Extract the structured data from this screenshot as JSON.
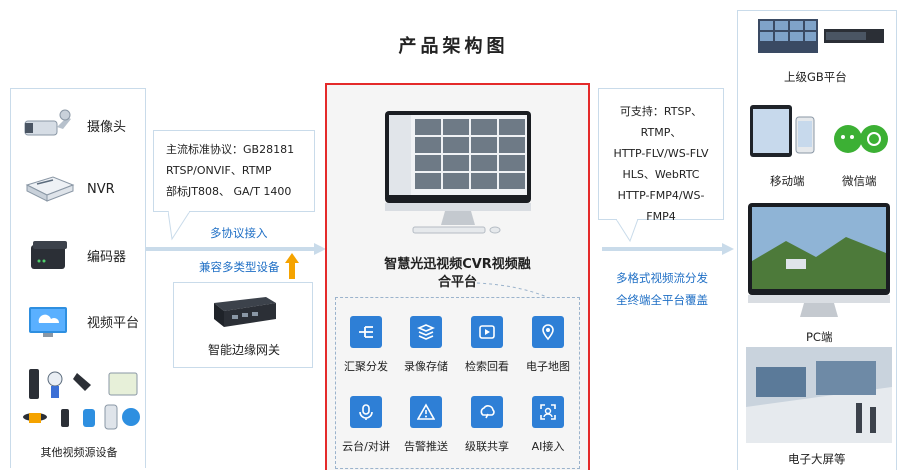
{
  "title": "产品架构图",
  "sources": [
    {
      "label": "摄像头",
      "icon": "camera-icon"
    },
    {
      "label": "NVR",
      "icon": "nvr-icon"
    },
    {
      "label": "编码器",
      "icon": "encoder-icon"
    },
    {
      "label": "视频平台",
      "icon": "video-platform-icon"
    }
  ],
  "other_sources_label": "其他视频源设备",
  "protocols_in": {
    "lines": [
      "主流标准协议：GB28181",
      "RTSP/ONVIF、RTMP",
      "部标JT808、 GA/T 1400"
    ],
    "caption": "多协议接入"
  },
  "compat_label": "兼容多类型设备",
  "gateway_label": "智能边缘网关",
  "platform": {
    "name_line1": "智慧光迅视频CVR视频融",
    "name_line2": "合平台"
  },
  "features": [
    {
      "label": "汇聚分发",
      "icon": "distribute-icon"
    },
    {
      "label": "录像存储",
      "icon": "storage-icon"
    },
    {
      "label": "检索回看",
      "icon": "playback-icon"
    },
    {
      "label": "电子地图",
      "icon": "map-icon"
    },
    {
      "label": "云台/对讲",
      "icon": "microphone-icon"
    },
    {
      "label": "告警推送",
      "icon": "alarm-icon"
    },
    {
      "label": "级联共享",
      "icon": "cascade-icon"
    },
    {
      "label": "AI接入",
      "icon": "ai-icon"
    }
  ],
  "protocols_out": {
    "lines": [
      "可支持：RTSP、RTMP、",
      "HTTP-FLV/WS-FLV",
      "HLS、WebRTC",
      "HTTP-FMP4/WS- FMP4"
    ],
    "caption_line1": "多格式视频流分发",
    "caption_line2": "全终端全平台覆盖"
  },
  "outputs": {
    "gb_platform": "上级GB平台",
    "mobile": "移动端",
    "wechat": "微信端",
    "pc": "PC端",
    "big_screen": "电子大屏等"
  },
  "colors": {
    "accent": "#1f6fc5",
    "feature_blue": "#2e7fd6",
    "center_border": "#e42a2a",
    "arrow": "#f5a300"
  }
}
